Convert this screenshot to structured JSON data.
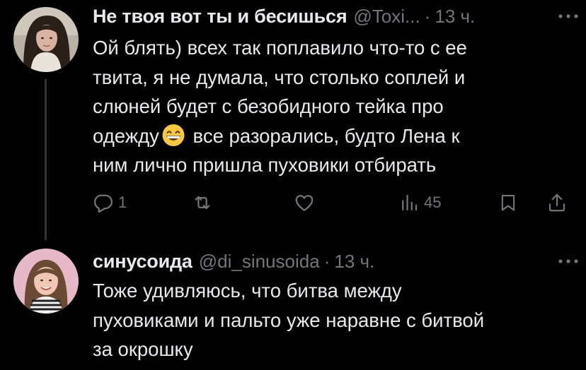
{
  "tweets": [
    {
      "author": {
        "display_name": "Не твоя вот ты и бесишься",
        "handle": "@Toxi...",
        "avatar_icon": "user-avatar-photo"
      },
      "separator": "·",
      "time": "13 ч.",
      "more_icon": "more-options-icon",
      "text_before_emoji": "Ой блять) всех так поплавило что-то с ее\nтвита, я не думала, что столько соплей и\nслюней будет с безобидного тейка про\nодежду",
      "emoji": "grinning-face-emoji",
      "text_after_emoji": " все разорались, будто Лена к\nним лично пришла пуховики отбирать",
      "actions": {
        "reply_count": "1",
        "retweet_count": "",
        "like_count": "",
        "views_count": "45"
      }
    },
    {
      "author": {
        "display_name": "синусоида",
        "handle": "@di_sinusoida",
        "avatar_icon": "user-avatar-photo"
      },
      "separator": "·",
      "time": "13 ч.",
      "more_icon": "more-options-icon",
      "text": "Тоже удивляюсь, что битва между\nпуховиками и пальто уже наравне с битвой\nза окрошку"
    }
  ],
  "colors": {
    "background": "#000000",
    "primary_text": "#e7e9ea",
    "secondary_text": "#71767b",
    "thread_line": "#333639"
  }
}
